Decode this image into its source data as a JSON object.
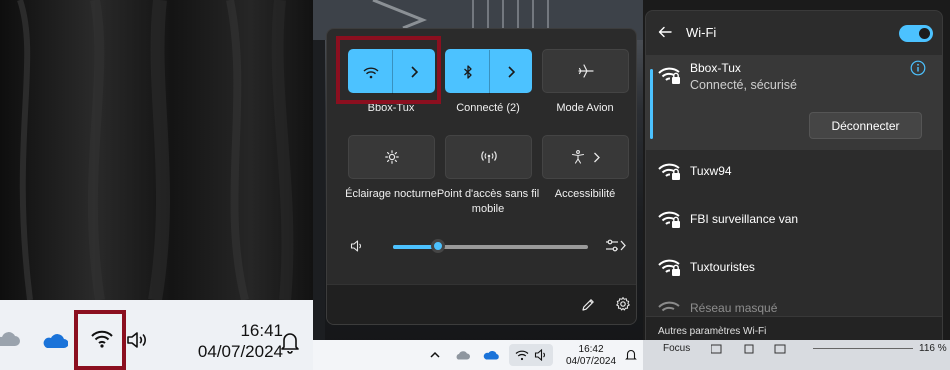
{
  "panel1": {
    "clock": {
      "time": "16:41",
      "date": "04/07/2024"
    },
    "taskbar_icons": [
      "cloud-icon",
      "onedrive-icon",
      "wifi-icon",
      "volume-icon",
      "bell-icon"
    ]
  },
  "quick_settings": {
    "tiles": [
      {
        "label": "Bbox-Tux",
        "icon": "wifi-icon",
        "active": true,
        "split": true
      },
      {
        "label": "Connecté (2)",
        "icon": "bluetooth-icon",
        "active": true,
        "split": true
      },
      {
        "label": "Mode Avion",
        "icon": "airplane-icon",
        "active": false,
        "split": false
      },
      {
        "label": "Éclairage nocturne",
        "icon": "brightness-icon",
        "active": false,
        "split": false
      },
      {
        "label": "Point d'accès sans fil mobile",
        "icon": "hotspot-icon",
        "active": false,
        "split": false
      },
      {
        "label": "Accessibilité",
        "icon": "accessibility-icon",
        "active": false,
        "split": true
      }
    ],
    "volume_level": 0.23,
    "taskbar": {
      "time": "16:42",
      "date": "04/07/2024"
    }
  },
  "wifi": {
    "title": "Wi-Fi",
    "enabled": true,
    "active_network": {
      "name": "Bbox-Tux",
      "status": "Connecté, sécurisé",
      "disconnect_label": "Déconnecter"
    },
    "networks": [
      {
        "name": "Tuxw94"
      },
      {
        "name": "FBI surveillance van"
      },
      {
        "name": "Tuxtouristes"
      },
      {
        "name": "Réseau masqué"
      }
    ],
    "footer": "Autres paramètres Wi-Fi",
    "taskbar": {
      "focus": "Focus",
      "zoom": "116 %"
    }
  },
  "colors": {
    "accent": "#4cc2ff",
    "highlight": "#8b0f1f"
  }
}
